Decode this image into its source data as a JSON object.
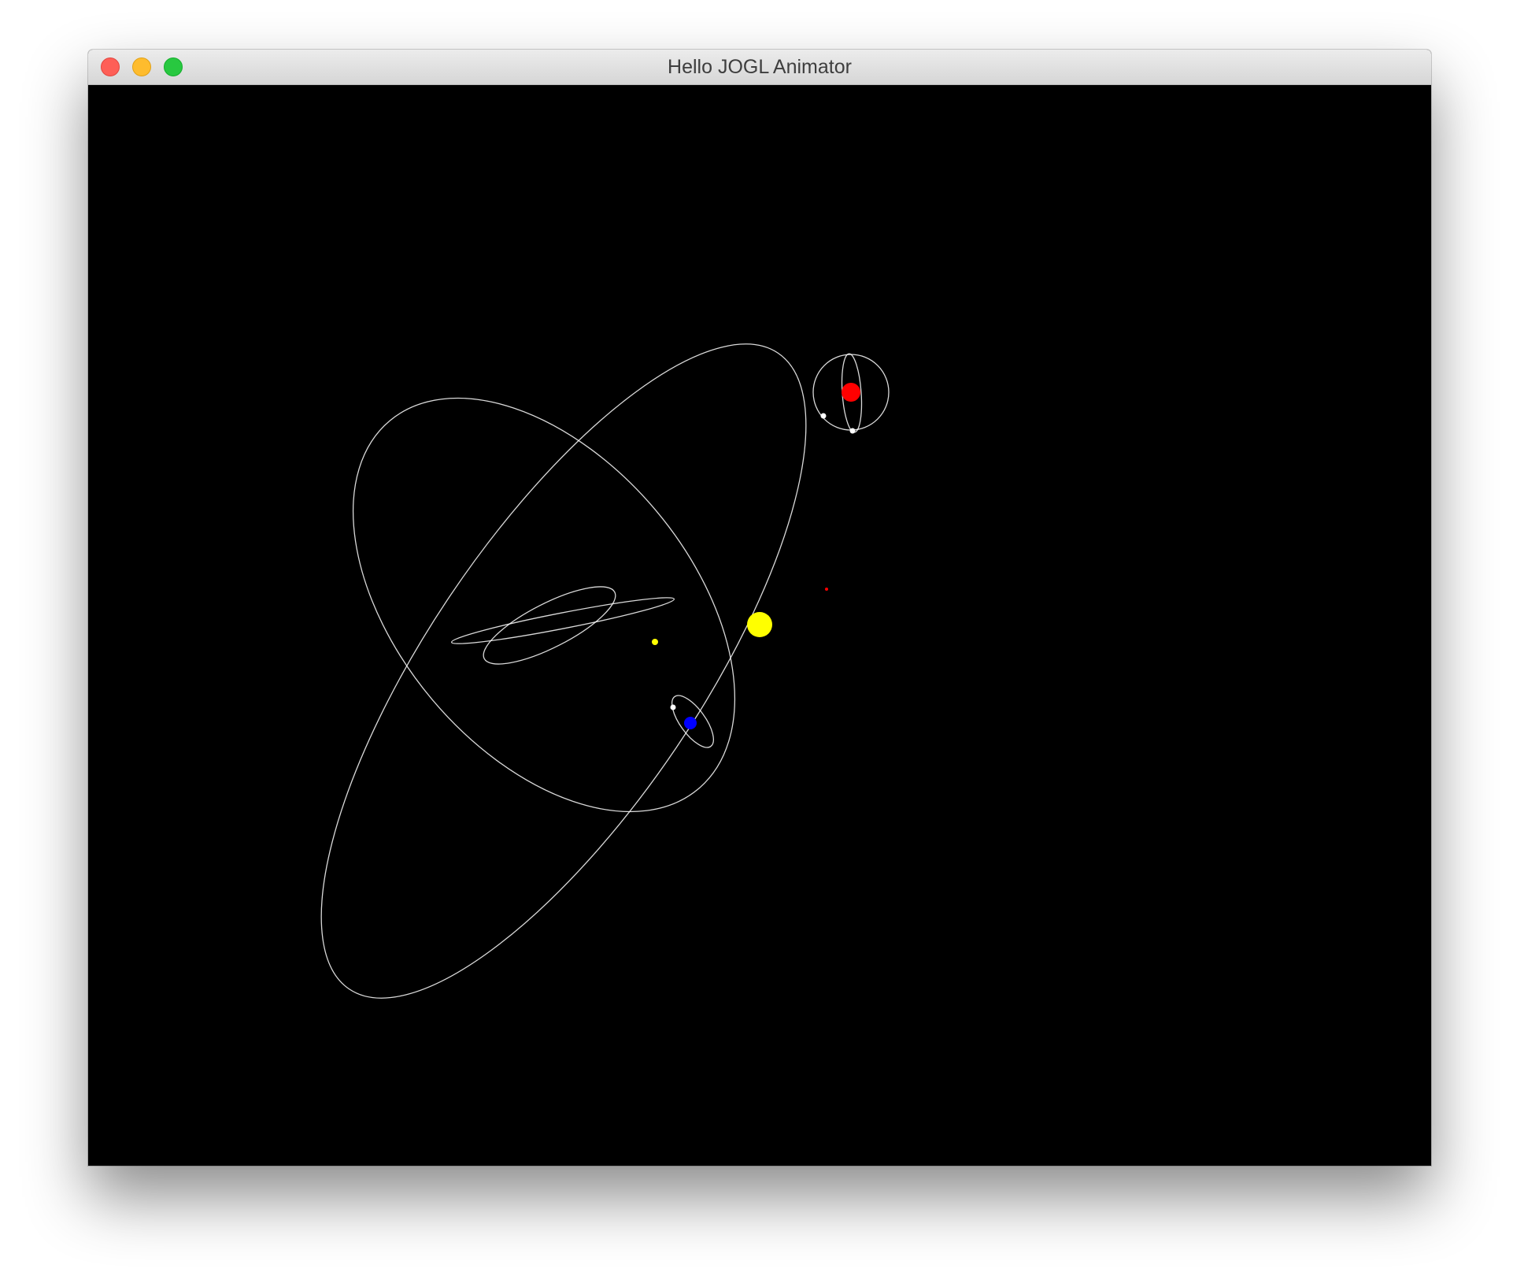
{
  "window": {
    "title": "Hello JOGL Animator"
  },
  "colors": {
    "background": "#000000",
    "orbit_line": "#ffffff",
    "sun": "#ffff00",
    "red_planet": "#ff0000",
    "blue_planet": "#0000ff",
    "yellow_moon": "#ffff00",
    "moon": "#ffffff"
  },
  "scene": {
    "bodies": [
      "sun",
      "red-planet",
      "blue-planet",
      "yellow-moon",
      "white-moons"
    ],
    "orbits": [
      "outer-orbit-large",
      "orbit-medium",
      "inner-orbit-1",
      "inner-orbit-2",
      "red-planet-moon-orbits",
      "blue-planet-moon-orbit"
    ]
  }
}
